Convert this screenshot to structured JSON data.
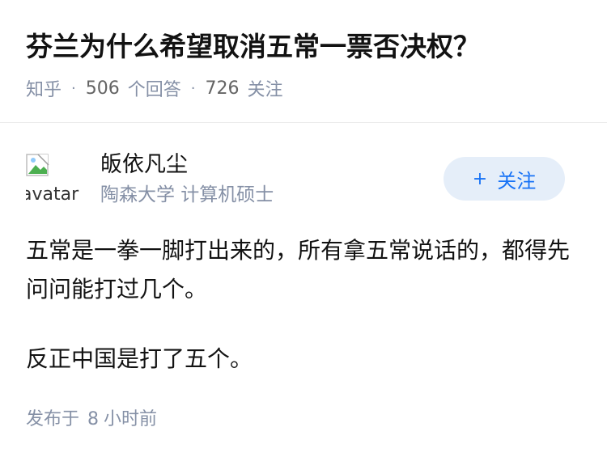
{
  "question": {
    "title": "芬兰为什么希望取消五常一票否决权？",
    "source": "知乎",
    "answer_count": "506",
    "answer_label": "个回答",
    "follower_count": "726",
    "follower_label": "关注",
    "separator": "·"
  },
  "author": {
    "name": "皈依凡尘",
    "headline": "陶森大学 计算机硕士",
    "avatar_alt": "avatar",
    "follow_icon": "+",
    "follow_label": "关注"
  },
  "answer": {
    "paragraphs": [
      "五常是一拳一脚打出来的，所有拿五常说话的，都得先问问能打过几个。",
      "反正中国是打了五个。"
    ]
  },
  "meta": {
    "published_prefix": "发布于",
    "published_value": "8",
    "published_suffix": "小时前"
  },
  "colors": {
    "title": "#121212",
    "meta_text": "#8590a6",
    "follow_bg": "#e5eef9",
    "follow_text": "#1772f6",
    "divider": "#ebebeb"
  }
}
